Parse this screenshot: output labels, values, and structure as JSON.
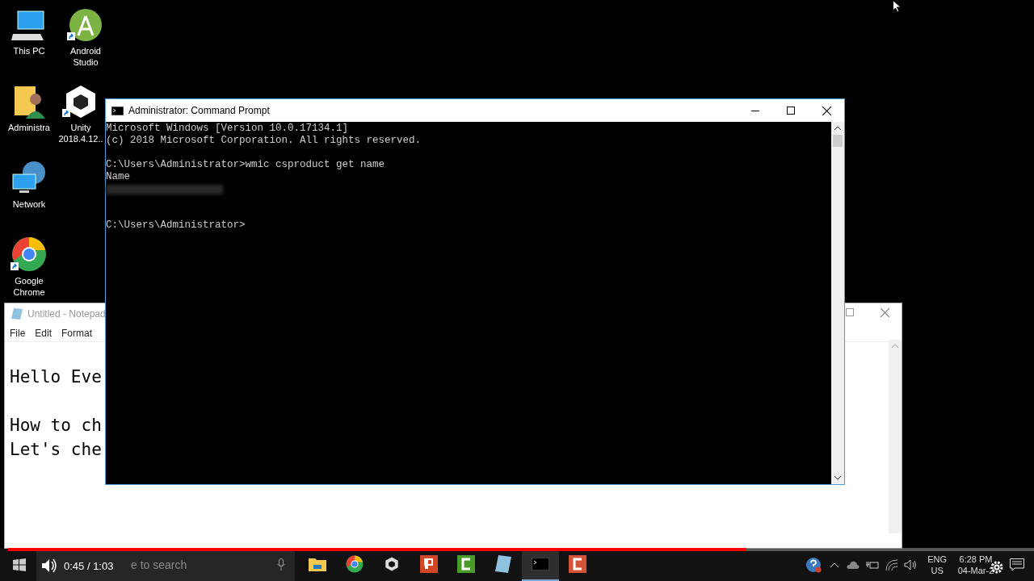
{
  "desktop_icons": [
    {
      "label": "This PC",
      "kind": "pc",
      "shortcut": false
    },
    {
      "label": "Android Studio",
      "kind": "android",
      "shortcut": true
    },
    {
      "label": "Administra",
      "kind": "user-folder",
      "shortcut": false
    },
    {
      "label": "Unity 2018.4.12..",
      "kind": "unity",
      "shortcut": true
    },
    {
      "label": "Network",
      "kind": "network",
      "shortcut": false
    },
    {
      "label": "Google Chrome",
      "kind": "chrome",
      "shortcut": true
    }
  ],
  "notepad": {
    "title": "Untitled - Notepad",
    "menu": [
      "File",
      "Edit",
      "Format"
    ],
    "paragraphs": [
      [
        "Hello Eve"
      ],
      [
        "How to ch",
        "Let's che"
      ]
    ]
  },
  "cmd": {
    "title": "Administrator: Command Prompt",
    "lines": [
      {
        "kind": "text",
        "text": "Microsoft Windows [Version 10.0.17134.1]"
      },
      {
        "kind": "text",
        "text": "(c) 2018 Microsoft Corporation. All rights reserved."
      },
      {
        "kind": "blank"
      },
      {
        "kind": "text",
        "text": "C:\\Users\\Administrator>wmic csproduct get name"
      },
      {
        "kind": "text",
        "text": "Name"
      },
      {
        "kind": "redacted"
      },
      {
        "kind": "blank"
      },
      {
        "kind": "blank"
      },
      {
        "kind": "text",
        "text": "C:\\Users\\Administrator>"
      }
    ]
  },
  "taskbar": {
    "search_placeholder": "e to search",
    "apps": [
      {
        "kind": "folder",
        "selected": false
      },
      {
        "kind": "chrome",
        "selected": false
      },
      {
        "kind": "unity",
        "selected": false
      },
      {
        "kind": "powerpoint",
        "selected": false
      },
      {
        "kind": "camtasia",
        "selected": false
      },
      {
        "kind": "notepad",
        "selected": false
      },
      {
        "kind": "terminal",
        "selected": true
      },
      {
        "kind": "recorder",
        "selected": false
      }
    ],
    "language": "ENG",
    "region": "US",
    "time": "6:28 PM",
    "date": "04-Mar-2"
  },
  "video_player": {
    "level": 0.72,
    "time": "0:45 / 1:03"
  }
}
